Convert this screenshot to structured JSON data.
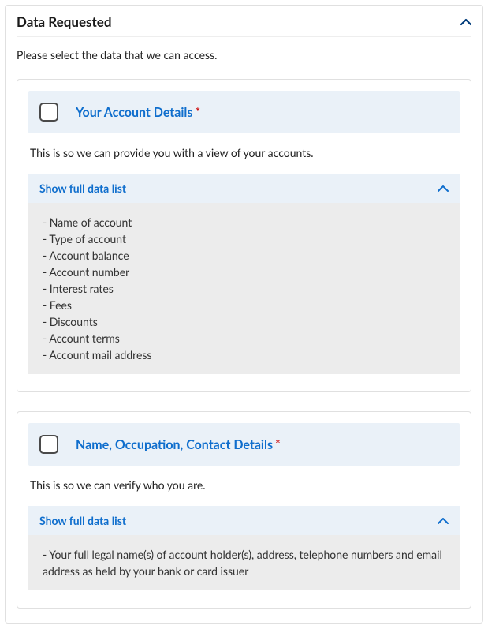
{
  "header": {
    "title": "Data Requested"
  },
  "instruction": "Please select the data that we can access.",
  "toggle_label": "Show full data list",
  "sections": [
    {
      "label": "Your Account Details",
      "required": true,
      "description": "This is so we can provide you with a view of your accounts.",
      "items": [
        "Name of account",
        "Type of account",
        "Account balance",
        "Account number",
        "Interest rates",
        "Fees",
        "Discounts",
        "Account terms",
        "Account mail address"
      ]
    },
    {
      "label": "Name, Occupation, Contact Details",
      "required": true,
      "description": "This is so we can verify who you are.",
      "items": [
        "Your full legal name(s) of account holder(s), address, telephone numbers and email address as held by your bank or card issuer"
      ]
    }
  ]
}
